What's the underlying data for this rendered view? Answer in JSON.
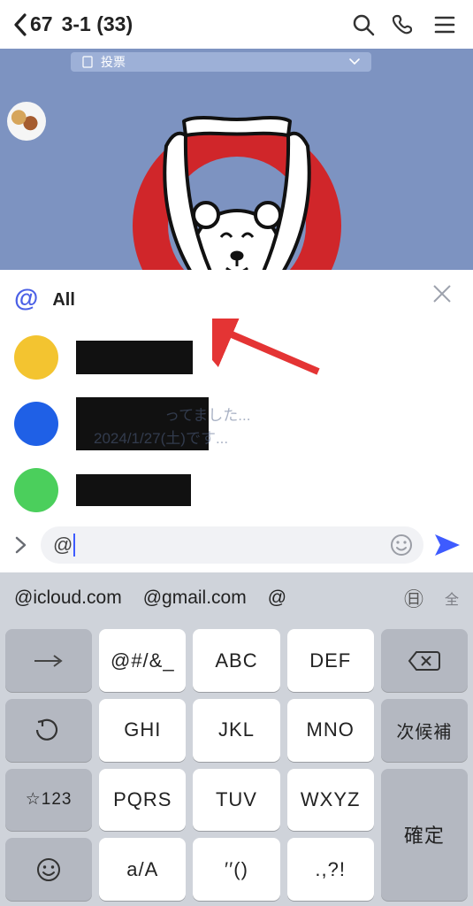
{
  "header": {
    "back_count": "67",
    "title": "3-1 (33)"
  },
  "chat": {
    "tab_label": "投票",
    "avatar_name": "user-avatar"
  },
  "mention": {
    "at_label": "@",
    "all_label": "All",
    "items": [
      {
        "avatar_color": "yellow",
        "name_width": 132
      },
      {
        "avatar_color": "blue",
        "name_width": 150
      },
      {
        "avatar_color": "green",
        "name_width": 130
      }
    ],
    "ghost_line1": "ってました...",
    "ghost_line2": "2024/1/27(土)です..."
  },
  "input": {
    "value": "@",
    "placeholder": ""
  },
  "keyboard": {
    "suggestions": [
      "@icloud.com",
      "@gmail.com",
      "@"
    ],
    "suggestion_tag": "全",
    "keys": {
      "r1": [
        "→",
        "@#/&_",
        "ABC",
        "DEF",
        "⌫"
      ],
      "r2": [
        "↺",
        "GHI",
        "JKL",
        "MNO",
        "次候補"
      ],
      "r3": [
        "☆123",
        "PQRS",
        "TUV",
        "WXYZ",
        "確定"
      ],
      "r4": [
        "😀",
        "a/A",
        "′′()",
        ".,?!",
        ""
      ]
    }
  }
}
